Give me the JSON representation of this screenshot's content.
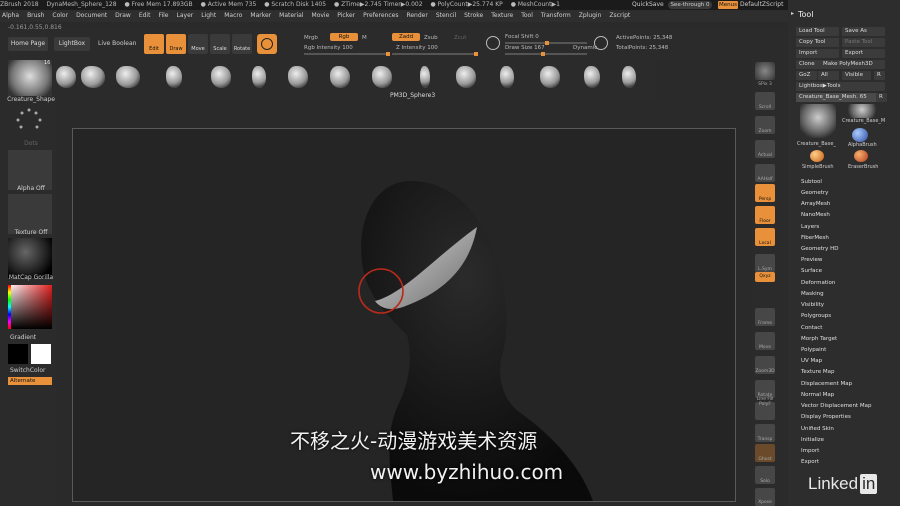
{
  "titlebar": [
    "ZBrush 2018",
    "DynaMesh_Sphere_128",
    "● Free Mem 17.893GB",
    "● Active Mem 735",
    "● Scratch Disk 1405",
    "● ZTime▶2.745 Timer▶0.002",
    "● PolyCount▶25.774 KP",
    "● MeshCount▶1"
  ],
  "quicksave": "QuickSave",
  "seethrough": "See-through  0",
  "menus_label": "Menus",
  "default_script": "DefaultZScript",
  "menubar": [
    "Alpha",
    "Brush",
    "Color",
    "Document",
    "Draw",
    "Edit",
    "File",
    "Layer",
    "Light",
    "Macro",
    "Marker",
    "Material",
    "Movie",
    "Picker",
    "Preferences",
    "Render",
    "Stencil",
    "Stroke",
    "Texture",
    "Tool",
    "Transform",
    "Zplugin",
    "Zscript"
  ],
  "coords": "-0.161,0.55,0.816",
  "top": {
    "home_page": "Home Page",
    "lightbox": "LightBox",
    "live_boolean": "Live Boolean",
    "edit": "Edit",
    "draw": "Draw",
    "move": "Move",
    "scale": "Scale",
    "rotate": "Rotate",
    "mrgb": "Mrgb",
    "rgb": "Rgb",
    "m": "M",
    "rgb_intensity": "Rgb Intensity 100",
    "zadd": "Zadd",
    "zsub": "Zsub",
    "zcut": "Zcut",
    "z_intensity": "Z Intensity 100",
    "focal_shift": "Focal Shift 0",
    "draw_size": "Draw Size 167",
    "dynamic": "Dynamic",
    "active_points": "ActivePoints: 25,348",
    "total_points": "TotalPoints: 25,348"
  },
  "brush_shelf_label": "PM3D_Sphere3",
  "left": {
    "tool_label": "Creature_Shape",
    "tool_count": "16",
    "dots_label": "Dots",
    "alpha_label": "Alpha Off",
    "texture_label": "Texture Off",
    "matcap_label": "MatCap Gorilla",
    "gradient_label": "Gradient",
    "switch_label": "SwitchColor",
    "alternate_label": "Alternate"
  },
  "right_shelf": [
    "SPix 3",
    "Scroll",
    "Zoom",
    "Actual",
    "AAHalf",
    "Persp",
    "Floor",
    "Local",
    "L.Sym",
    "Qxyz",
    "Frame",
    "Move",
    "Zoom3D",
    "Rotate",
    "Line Fill PolyF",
    "Transp",
    "Ghost",
    "Solo",
    "Xpose"
  ],
  "tool": {
    "title": "Tool",
    "load_tool": "Load Tool",
    "save_as": "Save As",
    "copy_tool": "Copy Tool",
    "paste_tool": "Paste Tool",
    "import": "Import",
    "export": "Export",
    "clone": "Clone",
    "make_polymesh": "Make PolyMesh3D",
    "goz": "GoZ",
    "all": "All",
    "visible": "Visible",
    "r": "R",
    "lightbox_tools": "Lightbox▶Tools",
    "current_tool": "Creature_Base_Mesh. 65",
    "r2": "R",
    "thumb1": "Creature_Base_",
    "thumb2": "AlphaBrush",
    "thumb3": "SimpleBrush",
    "thumb4": "EraserBrush",
    "thumb5": "Creature_Base_M",
    "submenus": [
      "Subtool",
      "Geometry",
      "ArrayMesh",
      "NanoMesh",
      "Layers",
      "FiberMesh",
      "Geometry HD",
      "Preview",
      "Surface",
      "Deformation",
      "Masking",
      "Visibility",
      "Polygroups",
      "Contact",
      "Morph Target",
      "Polypaint",
      "UV Map",
      "Texture Map",
      "Displacement Map",
      "Normal Map",
      "Vector Displacement Map",
      "Display Properties",
      "Unified Skin",
      "Initialize",
      "Import",
      "Export"
    ]
  },
  "watermark_cn": "不移之火-动漫游戏美术资源",
  "watermark_url": "www.byzhihuo.com",
  "linkedin": "Linked",
  "linkedin_in": "in",
  "colors": {
    "accent": "#e8913a",
    "panel": "#2b2b2b",
    "canvas": "#252525"
  }
}
